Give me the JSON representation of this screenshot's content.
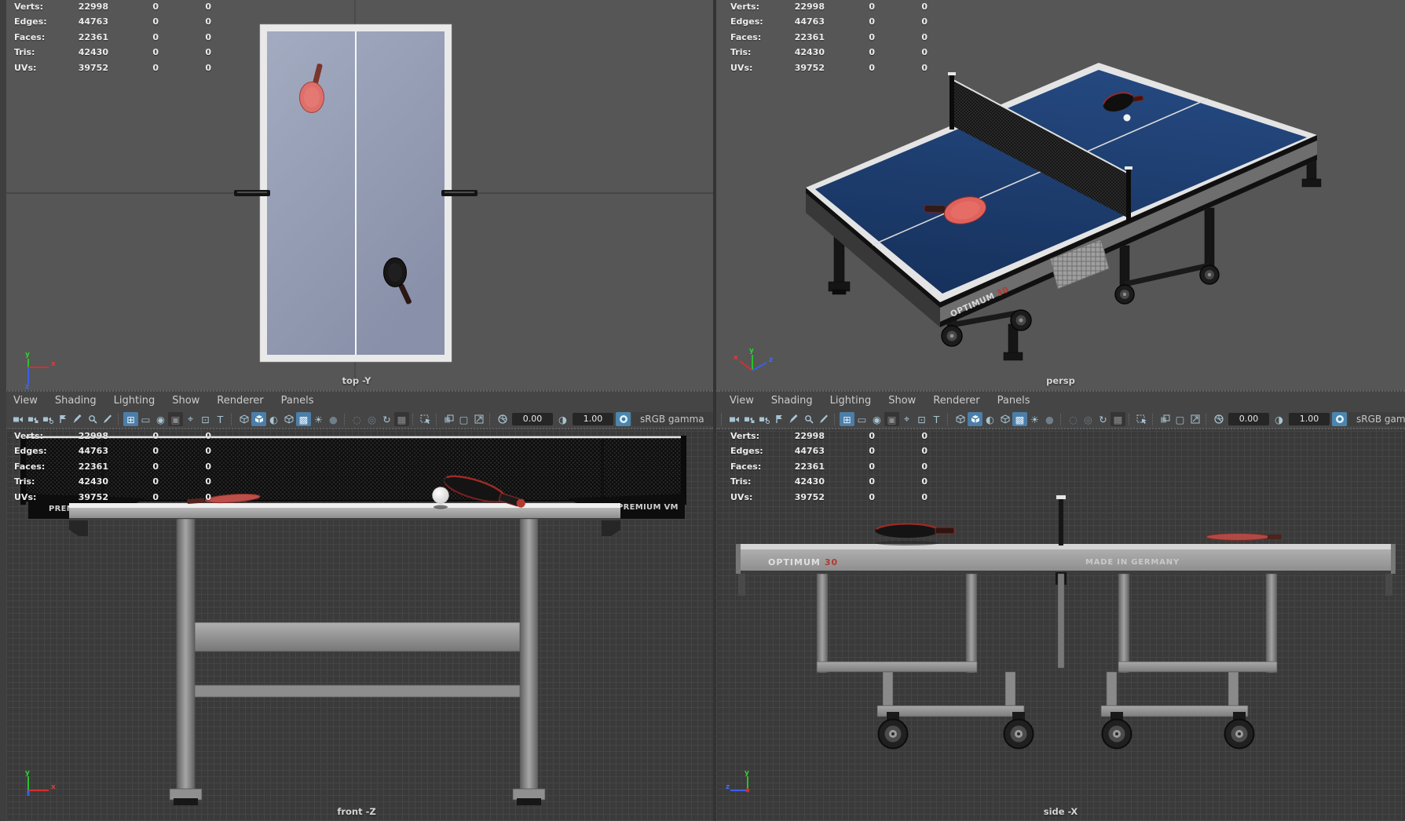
{
  "hud": {
    "rows": [
      {
        "label": "Verts:",
        "v1": "22998",
        "v2": "0",
        "v3": "0"
      },
      {
        "label": "Edges:",
        "v1": "44763",
        "v2": "0",
        "v3": "0"
      },
      {
        "label": "Faces:",
        "v1": "22361",
        "v2": "0",
        "v3": "0"
      },
      {
        "label": "Tris:",
        "v1": "42430",
        "v2": "0",
        "v3": "0"
      },
      {
        "label": "UVs:",
        "v1": "39752",
        "v2": "0",
        "v3": "0"
      }
    ]
  },
  "menus": {
    "items": [
      "View",
      "Shading",
      "Lighting",
      "Show",
      "Renderer",
      "Panels"
    ]
  },
  "toolbar": {
    "exposure_value": "0.00",
    "gamma_value": "1.00",
    "colorspace_label": "sRGB gamma",
    "icons": [
      {
        "name": "toolbar-separator",
        "sep": true
      },
      {
        "name": "select-camera-icon",
        "k": "camera"
      },
      {
        "name": "lock-camera-icon",
        "k": "cameralock"
      },
      {
        "name": "camera-attributes-icon",
        "k": "cameradot"
      },
      {
        "name": "bookmark-icon",
        "k": "flag"
      },
      {
        "name": "image-plane-icon",
        "k": "pen"
      },
      {
        "name": "pan-zoom-icon",
        "k": "magnify"
      },
      {
        "name": "grease-pencil-icon",
        "k": "marker"
      },
      {
        "name": "toolbar-separator",
        "sep": true
      },
      {
        "name": "grid-icon",
        "g": "⊞",
        "state": "on"
      },
      {
        "name": "film-gate-icon",
        "g": "▭"
      },
      {
        "name": "resolution-gate-icon",
        "g": "◉"
      },
      {
        "name": "gate-mask-icon",
        "g": "▣",
        "state": "dark"
      },
      {
        "name": "field-chart-icon",
        "g": "⌖"
      },
      {
        "name": "safe-action-icon",
        "g": "⊡"
      },
      {
        "name": "safe-title-icon",
        "g": "T"
      },
      {
        "name": "toolbar-separator",
        "sep": true
      },
      {
        "name": "wireframe-cube-icon",
        "k": "cubewire"
      },
      {
        "name": "smooth-shade-icon",
        "k": "cube",
        "state": "on"
      },
      {
        "name": "textured-icon",
        "g": "◐"
      },
      {
        "name": "default-material-icon",
        "k": "cubewire"
      },
      {
        "name": "checker-icon",
        "g": "▩",
        "state": "on"
      },
      {
        "name": "lights-icon",
        "g": "☀"
      },
      {
        "name": "shadows-icon",
        "g": "●",
        "state": "dim"
      },
      {
        "name": "toolbar-separator",
        "sep": true
      },
      {
        "name": "ao-icon",
        "g": "◌",
        "state": "dim"
      },
      {
        "name": "dof-icon",
        "g": "◎",
        "state": "dim"
      },
      {
        "name": "motion-blur-icon",
        "g": "↻"
      },
      {
        "name": "multisample-icon",
        "g": "▦",
        "state": "dark"
      },
      {
        "name": "toolbar-separator",
        "sep": true
      },
      {
        "name": "isolate-select-icon",
        "k": "isolate"
      },
      {
        "name": "toolbar-separator",
        "sep": true
      },
      {
        "name": "xray-active-icon",
        "k": "squares"
      },
      {
        "name": "xray-icon",
        "g": "▢"
      },
      {
        "name": "snapshot-icon",
        "k": "diag"
      },
      {
        "name": "toolbar-separator",
        "sep": true
      },
      {
        "name": "exposure-icon",
        "k": "aperture"
      },
      {
        "name": "exposure-field",
        "field": "exposure_value"
      },
      {
        "name": "contrast-icon",
        "g": "◑"
      },
      {
        "name": "gamma-field",
        "field": "gamma_value"
      },
      {
        "name": "gamma-toggle-button",
        "k": "toggle",
        "state": "blue"
      },
      {
        "name": "colorspace-select",
        "field": "colorspace_label",
        "wide": true
      },
      {
        "name": "toolbar-separator",
        "sep": true
      }
    ]
  },
  "viewports": {
    "top": {
      "label": "top -Y"
    },
    "persp": {
      "label": "persp"
    },
    "front": {
      "label": "front -Z"
    },
    "side": {
      "label": "side -X"
    }
  },
  "axes": {
    "x": "x",
    "y": "y",
    "z": "z"
  },
  "model": {
    "brand": "OPTIMUM",
    "brand_number": "30",
    "made_in": "MADE IN GERMANY",
    "net_brand": "PREMIUM VM"
  },
  "colors": {
    "viewport_bg": "#565656",
    "grid_bg": "#3a3a3a",
    "accent_blue": "#4c7ea8",
    "table_blue": "#1d3c72",
    "paddle_red": "#e0625c",
    "brand_red": "#b23a31"
  }
}
